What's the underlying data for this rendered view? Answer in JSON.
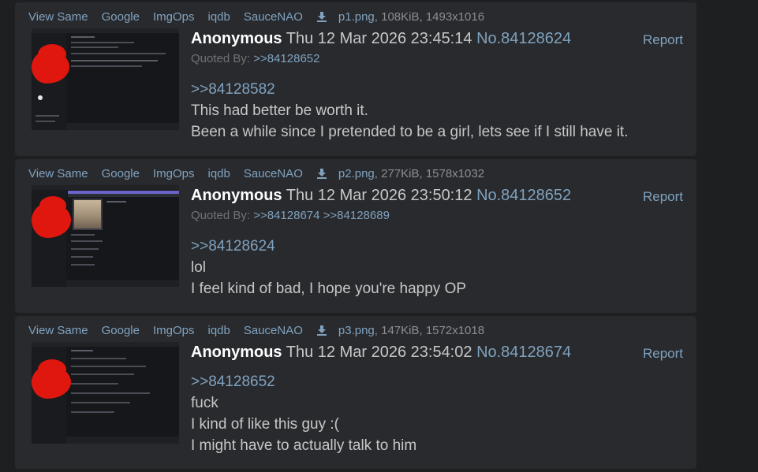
{
  "services": [
    "View Same",
    "Google",
    "ImgOps",
    "iqdb",
    "SauceNAO"
  ],
  "icons": {
    "download": "download-icon"
  },
  "colors": {
    "background": "#1d1f21",
    "post_bg": "#282a2e",
    "link": "#81a2be",
    "name": "#ffffff",
    "text": "#c5c8c6"
  },
  "report_label": "Report",
  "quoted_by_label": "Quoted By:",
  "posts": [
    {
      "filename": "p1.png",
      "filemeta": ", 108KiB, 1493x1016",
      "name": "Anonymous",
      "date": "Thu 12 Mar 2026 23:45:14",
      "number": "No.84128624",
      "quoted_by": [
        ">>84128652"
      ],
      "reply_to": ">>84128582",
      "lines": [
        "This had better be worth it.",
        "Been a while since I pretended to be a girl, lets see if I still have it."
      ]
    },
    {
      "filename": "p2.png",
      "filemeta": ", 277KiB, 1578x1032",
      "name": "Anonymous",
      "date": "Thu 12 Mar 2026 23:50:12",
      "number": "No.84128652",
      "quoted_by": [
        ">>84128674",
        ">>84128689"
      ],
      "reply_to": ">>84128624",
      "lines": [
        "lol",
        "I feel kind of bad, I hope you're happy OP"
      ]
    },
    {
      "filename": "p3.png",
      "filemeta": ", 147KiB, 1572x1018",
      "name": "Anonymous",
      "date": "Thu 12 Mar 2026 23:54:02",
      "number": "No.84128674",
      "quoted_by": [],
      "reply_to": ">>84128652",
      "lines": [
        "fuck",
        "I kind of like this guy :(",
        "I might have to actually talk to him"
      ]
    }
  ]
}
